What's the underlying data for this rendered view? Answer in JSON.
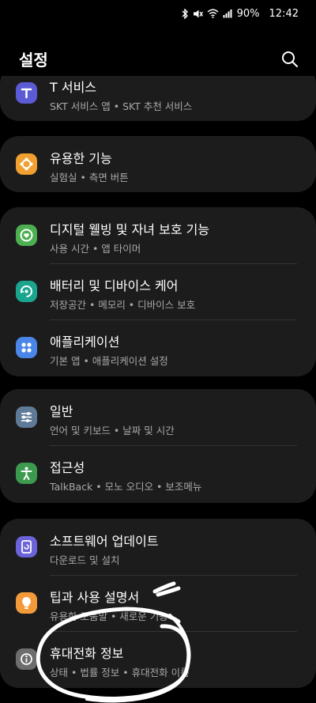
{
  "status": {
    "battery_percent": "90%",
    "time": "12:42",
    "icons": [
      "bluetooth-icon",
      "mute-icon",
      "wifi-icon",
      "signal-icon"
    ]
  },
  "header": {
    "title": "설정",
    "search_icon": "search-icon"
  },
  "groups": [
    {
      "items": [
        {
          "title": "T 서비스",
          "subtitle": "SKT 서비스 앱  •  SKT 추천 서비스",
          "icon": "t-service-icon",
          "color": "#5b5bd6"
        }
      ]
    },
    {
      "items": [
        {
          "title": "유용한 기능",
          "subtitle": "실험실  •  측면 버튼",
          "icon": "puzzle-star-icon",
          "color": "#f0a030"
        }
      ]
    },
    {
      "items": [
        {
          "title": "디지털 웰빙 및 자녀 보호 기능",
          "subtitle": "사용 시간  •  앱 타이머",
          "icon": "wellbeing-icon",
          "color": "#4caf50"
        },
        {
          "title": "배터리 및 디바이스 케어",
          "subtitle": "저장공간  •  메모리  •  디바이스 보호",
          "icon": "device-care-icon",
          "color": "#1aa58f"
        },
        {
          "title": "애플리케이션",
          "subtitle": "기본 앱  •  애플리케이션 설정",
          "icon": "apps-icon",
          "color": "#4a86e8"
        }
      ]
    },
    {
      "items": [
        {
          "title": "일반",
          "subtitle": "언어 및 키보드  •  날짜 및 시간",
          "icon": "sliders-icon",
          "color": "#5e7a96"
        },
        {
          "title": "접근성",
          "subtitle": "TalkBack  •  모노 오디오  •  보조메뉴",
          "icon": "accessibility-icon",
          "color": "#3c9a4e"
        }
      ]
    },
    {
      "items": [
        {
          "title": "소프트웨어 업데이트",
          "subtitle": "다운로드 및 설치",
          "icon": "software-update-icon",
          "color": "#6b63d9"
        },
        {
          "title": "팁과 사용 설명서",
          "subtitle": "유용한 도움말  •  새로운 기능",
          "icon": "lightbulb-icon",
          "color": "#f29a3a"
        },
        {
          "title": "휴대전화 정보",
          "subtitle": "상태  •  법률 정보  •  휴대전화 이름",
          "icon": "info-icon",
          "color": "#6d6d6d"
        }
      ]
    }
  ]
}
